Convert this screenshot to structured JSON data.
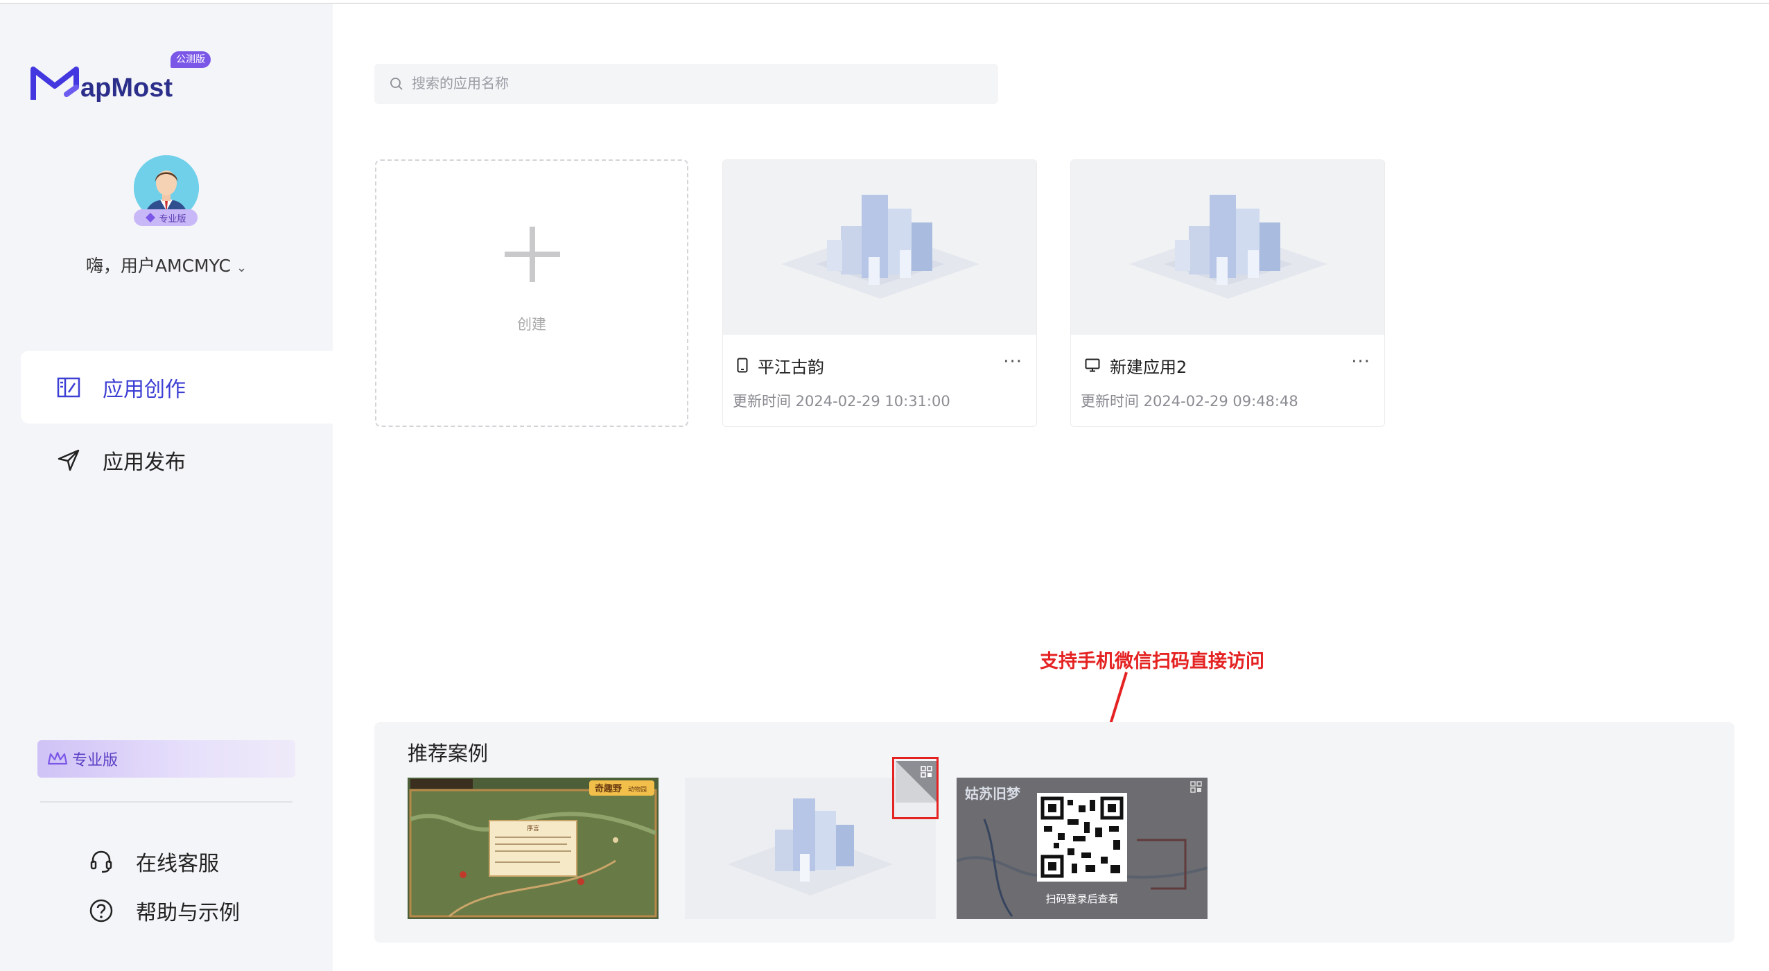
{
  "app": {
    "logo_text": "apMost",
    "beta_badge": "公测版"
  },
  "user": {
    "plan_chip": "专业版",
    "greeting": "嗨，用户AMCMYC"
  },
  "nav": {
    "items": [
      {
        "label": "应用创作",
        "icon": "app-create-icon",
        "active": true
      },
      {
        "label": "应用发布",
        "icon": "send-icon",
        "active": false
      }
    ]
  },
  "sidebar_bottom": {
    "plan_banner": "专业版",
    "links": [
      {
        "label": "在线客服",
        "icon": "headset-icon"
      },
      {
        "label": "帮助与示例",
        "icon": "help-circle-icon"
      }
    ]
  },
  "search": {
    "placeholder": "搜索的应用名称"
  },
  "create_card": {
    "label": "创建"
  },
  "apps": [
    {
      "name": "平江古韵",
      "device": "mobile-icon",
      "updated": "更新时间 2024-02-29 10:31:00"
    },
    {
      "name": "新建应用2",
      "device": "desktop-icon",
      "updated": "更新时间 2024-02-29 09:48:48"
    }
  ],
  "recommended": {
    "title": "推荐案例",
    "items": [
      {
        "map_title": "奇趣野",
        "tag": "动物园",
        "dialog_title": "序言"
      },
      {
        "qr_icon": "qr-code-icon"
      },
      {
        "map_title": "姑苏旧梦",
        "overlay_caption": "扫码登录后查看",
        "qr_icon": "qr-code-icon"
      }
    ]
  },
  "annotation": {
    "text": "支持手机微信扫码直接访问"
  },
  "colors": {
    "accent": "#3d3fd4",
    "sidebar_bg": "#f4f5f8",
    "annotation": "#e52222"
  }
}
